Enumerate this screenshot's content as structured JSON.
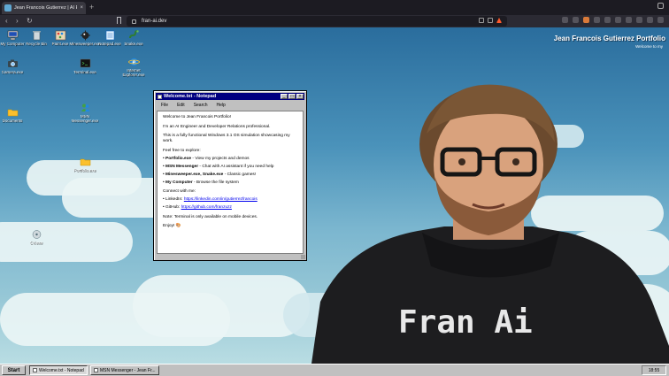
{
  "browser": {
    "tab_title": "Jean Francois Gutierrez | AI En...",
    "new_tab": "+",
    "url": "fran-ai.dev",
    "nav": {
      "back": "‹",
      "forward": "›",
      "reload": "↻"
    }
  },
  "desktop": {
    "brand_title": "Jean Francois Gutierrez Portfolio",
    "brand_sub": "Welcome to my",
    "icons": [
      {
        "label": "My Computer",
        "icon": "computer-icon"
      },
      {
        "label": "Recycle Bin",
        "icon": "recycle-bin-icon"
      },
      {
        "label": "Paint.exe",
        "icon": "paint-icon"
      },
      {
        "label": "Minesweeper.exe",
        "icon": "minesweeper-icon"
      },
      {
        "label": "Notepad.exe",
        "icon": "notepad-icon"
      },
      {
        "label": "Snake.exe",
        "icon": "snake-icon"
      },
      {
        "label": "Camera.exe",
        "icon": "camera-icon"
      },
      {
        "label": "Terminal.exe",
        "icon": "terminal-icon"
      },
      {
        "label": "Internet Explorer.exe",
        "icon": "ie-icon"
      },
      {
        "label": "Documents",
        "icon": "folder-icon"
      },
      {
        "label": "MSN Messenger.exe",
        "icon": "msn-icon"
      },
      {
        "label": "Portfolio.exe",
        "icon": "folder-icon"
      },
      {
        "label": "CV.exe",
        "icon": "cd-icon"
      }
    ]
  },
  "notepad": {
    "title": "Welcome.txt - Notepad",
    "menu": [
      "File",
      "Edit",
      "Search",
      "Help"
    ],
    "lines": {
      "intro": "Welcome to Jean Francois Portfolio!",
      "role": "I'm an AI Engineer and Developer Relations professional.",
      "desc": "This is a fully functional Windows 3.1 OS simulation showcasing my work.",
      "explore": "Feel free to explore:",
      "b1_bold": "• Portfolio.exe",
      "b1_rest": " - View my projects and demos",
      "b2_bold": "• MSN Messenger",
      "b2_rest": " - Chat with AI assistant if you need help",
      "b3_bold": "• Minesweeper.exe, Snake.exe",
      "b3_rest": " - Classic games!",
      "b4_bold": "• My Computer",
      "b4_rest": " - Browse the file system",
      "connect": "Connect with me:",
      "linkedin_label": "• LinkedIn: ",
      "linkedin_url": "https://linkedin.com/in/gutierrezfrancois",
      "github_label": "• GitHub: ",
      "github_url": "https://github.com/franzuzz",
      "note": "Note: Terminal is only available on mobile devices.",
      "enjoy": "Enjoy! 🎨"
    }
  },
  "taskbar": {
    "start": "Start",
    "tasks": [
      {
        "label": "Welcome.txt - Notepad"
      },
      {
        "label": "MSN Messenger - Jean Fr..."
      }
    ],
    "clock": "18:55"
  },
  "colors": {
    "titlebar": "#000080",
    "window": "#c0c0c0",
    "link": "#0000ee"
  }
}
